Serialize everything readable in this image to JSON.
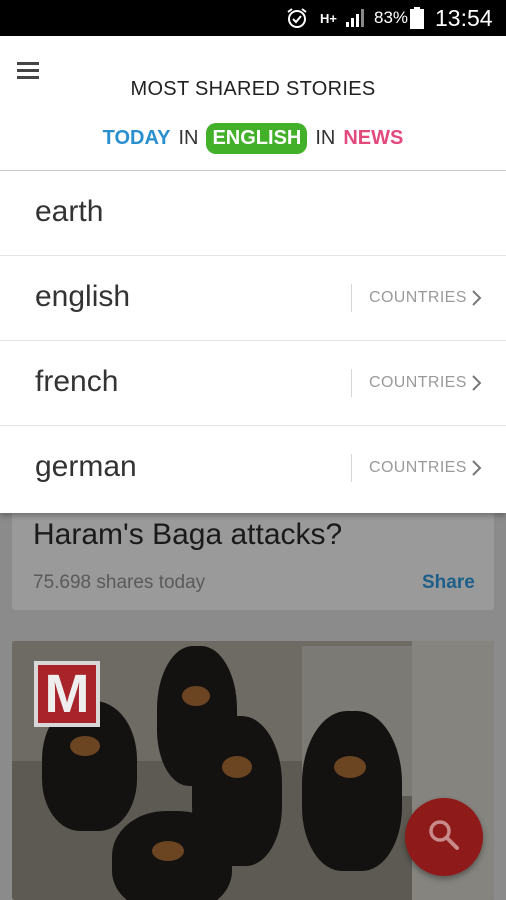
{
  "status_bar": {
    "network": "H+",
    "battery": "83%",
    "time": "13:54"
  },
  "header": {
    "title": "MOST SHARED STORIES",
    "filters": {
      "period": "TODAY",
      "in1": "IN",
      "language": "ENGLISH",
      "in2": "IN",
      "category": "NEWS"
    }
  },
  "dropdown": {
    "items": [
      {
        "label": "earth"
      },
      {
        "label": "english",
        "countries": "COUNTRIES"
      },
      {
        "label": "french",
        "countries": "COUNTRIES"
      },
      {
        "label": "german",
        "countries": "COUNTRIES"
      }
    ]
  },
  "feed": {
    "card1": {
      "title": "Haram's Baga attacks?",
      "shares": "75.698 shares today",
      "share_label": "Share"
    },
    "card2": {
      "logo_letter": "M"
    }
  },
  "colors": {
    "today": "#2a8fcf",
    "language_bg": "#43b02a",
    "news": "#e24a7c",
    "fab": "#8f1a1a"
  }
}
